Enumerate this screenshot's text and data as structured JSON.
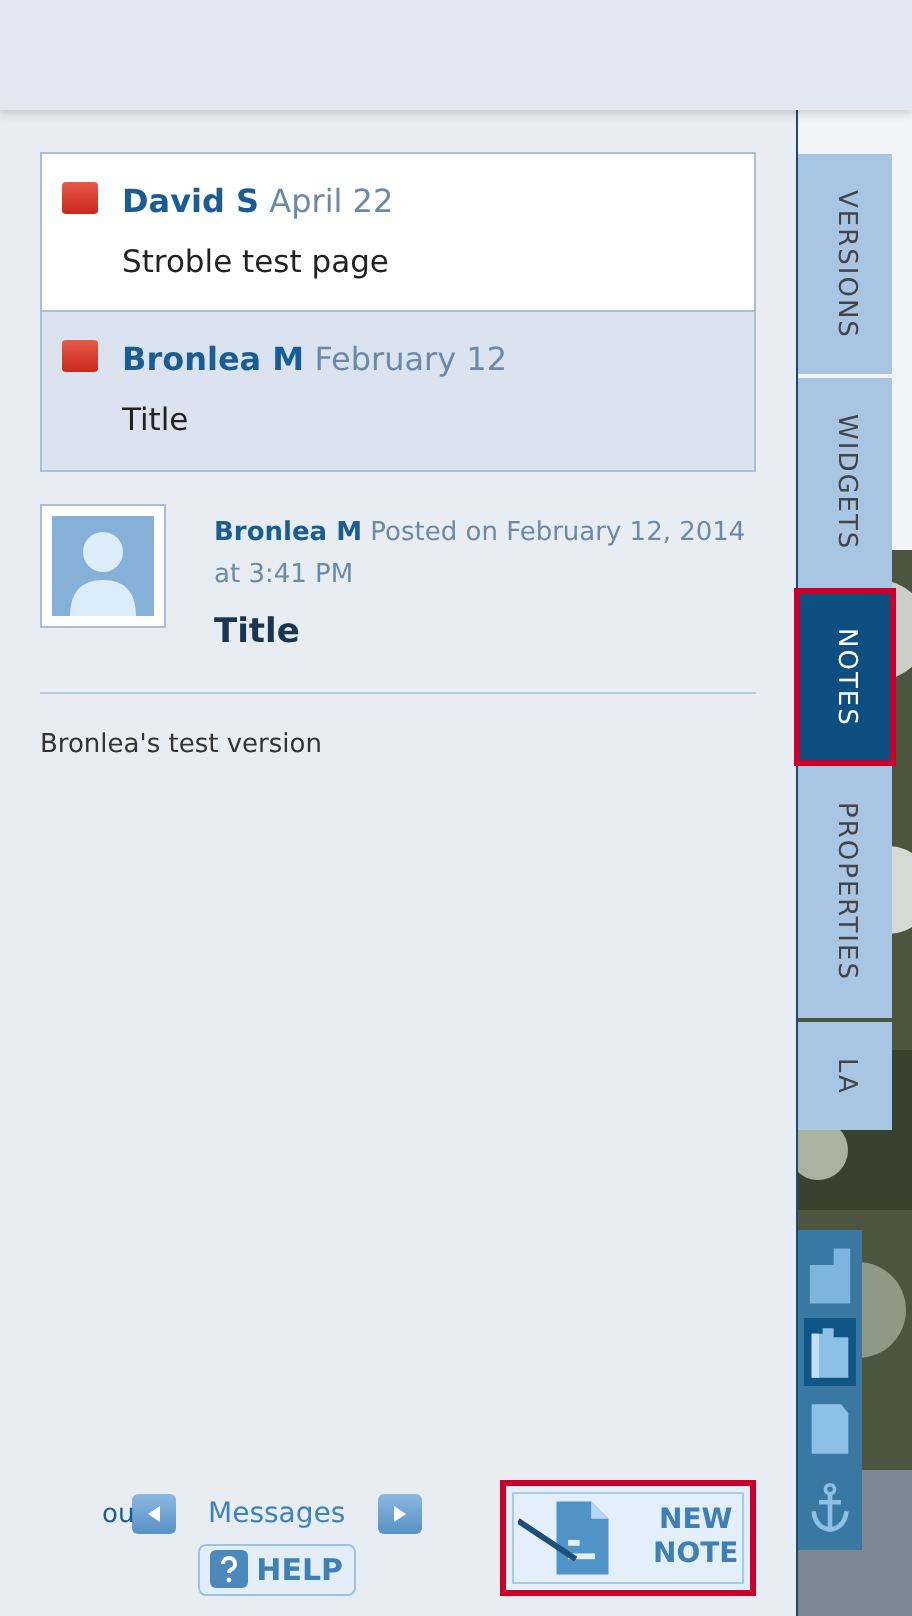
{
  "notes_list": [
    {
      "author": "David S",
      "date": "April 22",
      "title": "Stroble test page",
      "selected": false
    },
    {
      "author": "Bronlea M",
      "date": "February 12",
      "title": "Title",
      "selected": true
    }
  ],
  "note_detail": {
    "author": "Bronlea M",
    "posted": "Posted on February 12, 2014 at 3:41 PM",
    "title": "Title",
    "body": "Bronlea's test version"
  },
  "footer": {
    "overlap_text": "ou",
    "messages_label": "Messages",
    "help_label": "HELP",
    "new_note_label": "NEW NOTE"
  },
  "side_tabs": [
    {
      "label": "VERSIONS",
      "selected": false
    },
    {
      "label": "WIDGETS",
      "selected": false
    },
    {
      "label": "NOTES",
      "selected": true
    },
    {
      "label": "PROPERTIES",
      "selected": false
    },
    {
      "label": "LA",
      "selected": false
    }
  ],
  "layout_tools": [
    {
      "kind": "narrow",
      "selected": false
    },
    {
      "kind": "wide",
      "selected": true
    },
    {
      "kind": "full",
      "selected": false
    },
    {
      "kind": "anchor",
      "selected": false
    }
  ]
}
